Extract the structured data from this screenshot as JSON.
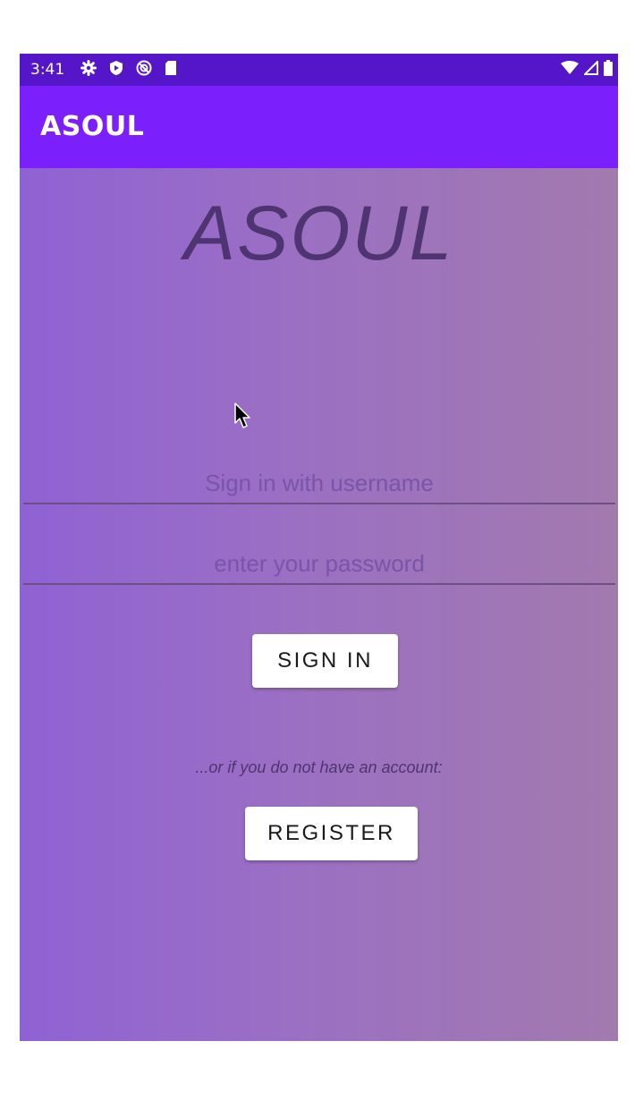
{
  "status_bar": {
    "time": "3:41",
    "left_icons": [
      "gear-icon",
      "shield-icon",
      "do-not-disturb-icon",
      "sd-card-icon"
    ],
    "right_icons": [
      "wifi-icon",
      "signal-icon",
      "battery-icon"
    ]
  },
  "app_bar": {
    "title": "ASOUL"
  },
  "login": {
    "logo_text": "ASOUL",
    "username_placeholder": "Sign in with username",
    "password_placeholder": "enter your password",
    "sign_in_label": "SIGN IN",
    "alt_prompt": "...or if you do not have an account:",
    "register_label": "REGISTER"
  },
  "colors": {
    "status_bar": "#5416c8",
    "app_bar": "#7b1ffd",
    "background_start": "#8f62d4",
    "background_end": "#a27aae",
    "logo_text": "#4f3472",
    "placeholder_text": "#7a54a9"
  }
}
